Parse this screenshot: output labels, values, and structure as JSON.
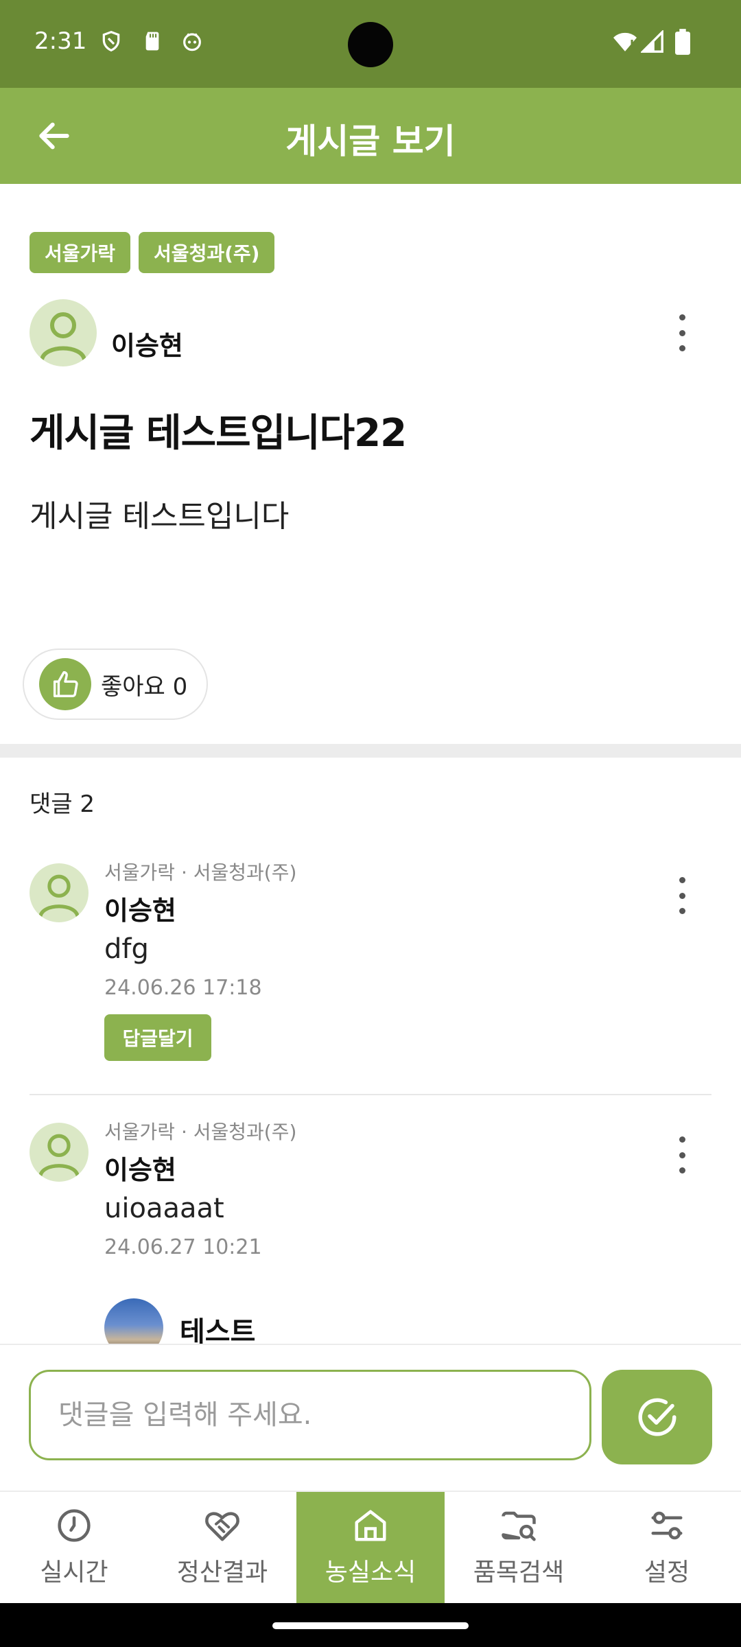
{
  "status_bar": {
    "time": "2:31"
  },
  "app_bar": {
    "title": "게시글 보기"
  },
  "post": {
    "tags": [
      "서울가락",
      "서울청과(주)"
    ],
    "author": "이승현",
    "title": "게시글 테스트입니다22",
    "body": "게시글 테스트입니다",
    "like_label": "좋아요 0"
  },
  "comments": {
    "count_label": "댓글 2",
    "items": [
      {
        "affiliation": "서울가락 · 서울청과(주)",
        "author": "이승현",
        "text": "dfg",
        "date": "24.06.26 17:18",
        "reply_label": "답글달기"
      },
      {
        "affiliation": "서울가락 · 서울청과(주)",
        "author": "이승현",
        "text": "uioaaaat",
        "date": "24.06.27 10:21",
        "reply": {
          "author": "테스트"
        }
      }
    ]
  },
  "comment_input": {
    "placeholder": "댓글을 입력해 주세요."
  },
  "bottom_nav": {
    "items": [
      {
        "label": "실시간",
        "icon": "clock-icon"
      },
      {
        "label": "정산결과",
        "icon": "handshake-heart-icon"
      },
      {
        "label": "농실소식",
        "icon": "home-icon"
      },
      {
        "label": "품목검색",
        "icon": "folder-search-icon"
      },
      {
        "label": "설정",
        "icon": "sliders-icon"
      }
    ],
    "active_index": 2
  },
  "colors": {
    "accent": "#8cb24f",
    "status_bar": "#6a8a35",
    "avatar_bg": "#dbe8c6"
  }
}
